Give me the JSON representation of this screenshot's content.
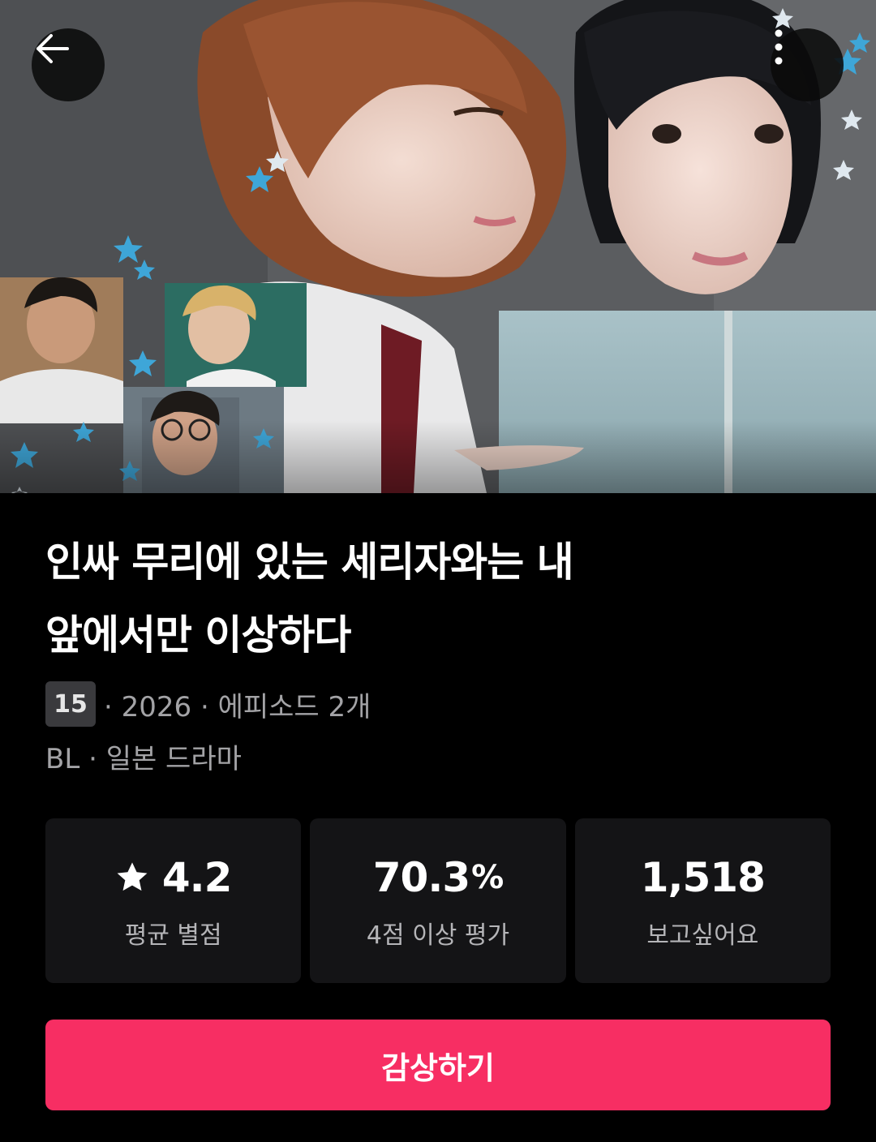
{
  "hero": {
    "image_description_icon": "poster-image",
    "back_icon": "arrow-left-icon",
    "more_icon": "more-vertical-icon"
  },
  "title": {
    "line1": "인싸 무리에 있는 세리자와는 내",
    "line2": "앞에서만 이상하다"
  },
  "meta": {
    "age_rating": "15",
    "year_text": "· 2026 · 에피소드 2개",
    "genre_text": "BL · 일본 드라마"
  },
  "stats": {
    "rating_value": "4.2",
    "rating_label": "평균 별점",
    "percent_value": "70.3",
    "percent_unit": "%",
    "percent_label": "4점 이상 평가",
    "wishlist_value": "1,518",
    "wishlist_label": "보고싶어요"
  },
  "cta": {
    "label": "감상하기"
  },
  "colors": {
    "background": "#000000",
    "card": "#141416",
    "accent": "#f72e63",
    "muted_text": "#a3a3a6"
  }
}
